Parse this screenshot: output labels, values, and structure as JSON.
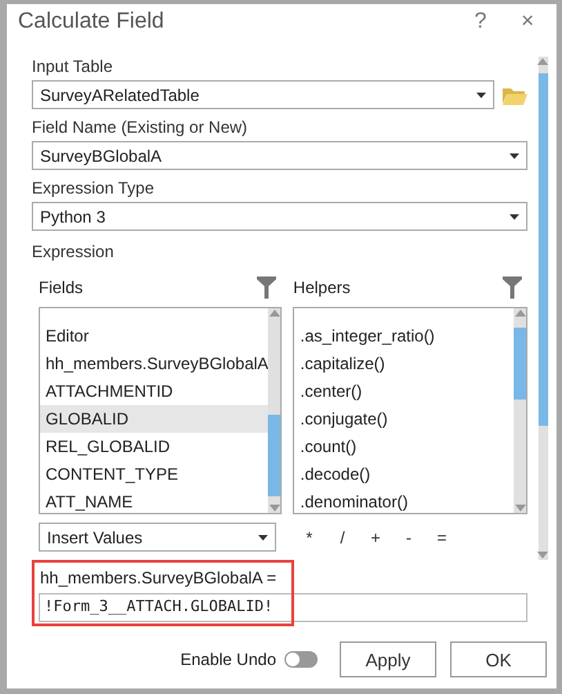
{
  "window": {
    "title": "Calculate Field",
    "help": "?",
    "close": "×"
  },
  "input_table": {
    "label": "Input Table",
    "value": "SurveyARelatedTable"
  },
  "field_name": {
    "label": "Field Name (Existing or New)",
    "value": "SurveyBGlobalA"
  },
  "expression_type": {
    "label": "Expression Type",
    "value": "Python 3"
  },
  "expression": {
    "label": "Expression",
    "fields": {
      "title": "Fields",
      "items": [
        {
          "label": "Editor",
          "selected": false
        },
        {
          "label": "hh_members.SurveyBGlobalA",
          "selected": false
        },
        {
          "label": "ATTACHMENTID",
          "selected": false
        },
        {
          "label": "GLOBALID",
          "selected": true
        },
        {
          "label": "REL_GLOBALID",
          "selected": false
        },
        {
          "label": "CONTENT_TYPE",
          "selected": false
        },
        {
          "label": "ATT_NAME",
          "selected": false
        }
      ]
    },
    "helpers": {
      "title": "Helpers",
      "items": [
        ".as_integer_ratio()",
        ".capitalize()",
        ".center()",
        ".conjugate()",
        ".count()",
        ".decode()",
        ".denominator()"
      ]
    },
    "insert_values": "Insert Values",
    "operators": [
      "*",
      "/",
      "+",
      "-",
      "="
    ],
    "target": "hh_members.SurveyBGlobalA =",
    "value": "!Form_3__ATTACH.GLOBALID!"
  },
  "enable_undo": {
    "label": "Enable Undo",
    "on": false
  },
  "buttons": [
    "Apply",
    "OK"
  ]
}
